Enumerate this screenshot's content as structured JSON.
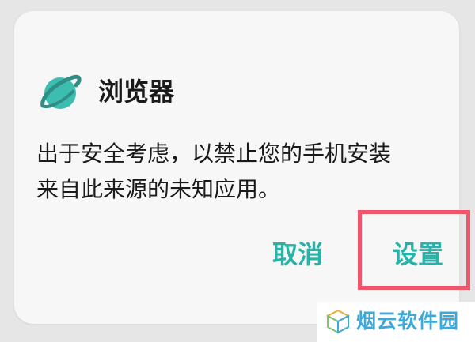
{
  "dialog": {
    "app_name": "浏览器",
    "app_icon": "browser-planet-icon",
    "message_line1": "出于安全考虑，以禁止您的手机安装",
    "message_line2": "来自此来源的未知应用。",
    "cancel_label": "取消",
    "settings_label": "设置"
  },
  "watermark": {
    "text": "烟云软件园",
    "logo_icon": "cube-logo-icon"
  },
  "colors": {
    "accent": "#26b3a8",
    "highlight_border": "#f0566a",
    "dialog_background": "#f7f7f7",
    "page_background": "#e6e6e6",
    "watermark_text": "#3ca9d9"
  }
}
